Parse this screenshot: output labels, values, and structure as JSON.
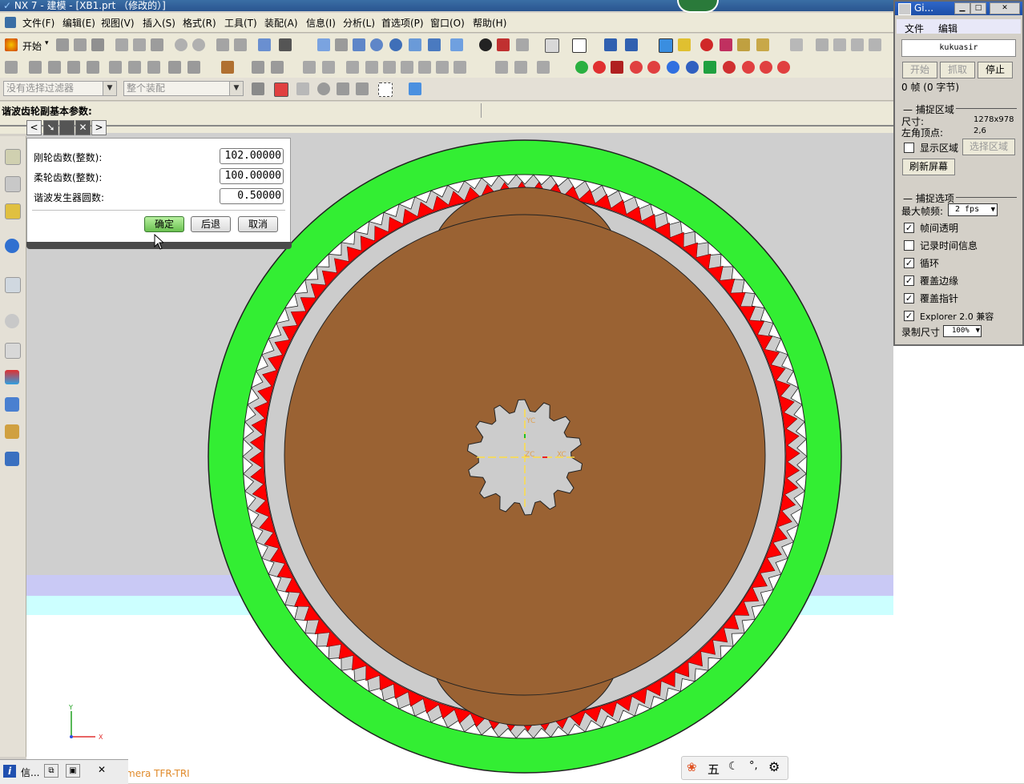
{
  "window": {
    "title": "NX 7 - 建模 - [XB1.prt （修改的）]"
  },
  "menubar": {
    "items": [
      "文件(F)",
      "编辑(E)",
      "视图(V)",
      "插入(S)",
      "格式(R)",
      "工具(T)",
      "装配(A)",
      "信息(I)",
      "分析(L)",
      "首选项(P)",
      "窗口(O)",
      "帮助(H)"
    ]
  },
  "toolbar": {
    "start_label": "开始"
  },
  "filterbar": {
    "filter_placeholder": "没有选择过滤器",
    "assembly_placeholder": "整个装配"
  },
  "cue": {
    "text": "谐波齿轮副基本参数:"
  },
  "dialog": {
    "fields": [
      {
        "label": "刚轮齿数(整数):",
        "value": "102.00000"
      },
      {
        "label": "柔轮齿数(整数):",
        "value": "100.00000"
      },
      {
        "label": "谐波发生器圆数:",
        "value": "0.50000"
      }
    ],
    "ok_label": "确定",
    "back_label": "后退",
    "cancel_label": "取消"
  },
  "viewport": {
    "triad_labels": {
      "x": "X",
      "y": "Y"
    },
    "mini_labels": {
      "yc": "YC",
      "xc": "XC",
      "zc": "ZC"
    },
    "camera_text": "mera TFR-TRI"
  },
  "capture_panel": {
    "title": "Gi...",
    "menu_file": "文件",
    "menu_edit": "编辑",
    "username": "kukuasir",
    "start_label": "开始",
    "grab_label": "抓取",
    "stop_label": "停止",
    "frames_info": "0 帧 (0 字节)",
    "section_region": "捕捉区域",
    "size_label": "尺寸:",
    "size_value": "1278x978",
    "corner_label": "左角顶点:",
    "corner_value": "2,6",
    "show_region_label": "显示区域",
    "select_region_label": "选择区域",
    "refresh_label": "刷新屏幕",
    "section_options": "捕捉选项",
    "max_fps_label": "最大帧频:",
    "max_fps_value": "2 fps",
    "options": [
      {
        "label": "帧间透明",
        "checked": true
      },
      {
        "label": "记录时间信息",
        "checked": false
      },
      {
        "label": "循环",
        "checked": true
      },
      {
        "label": "覆盖边缘",
        "checked": true
      },
      {
        "label": "覆盖指针",
        "checked": true
      },
      {
        "label": "Explorer 2.0 兼容",
        "checked": true
      }
    ],
    "record_size_label": "录制尺寸",
    "record_size_value": "100%"
  },
  "taskbar": {
    "info_label": "信..."
  },
  "ime": {
    "wubi_label": "五"
  },
  "colors": {
    "outer_ring": "#33ee33",
    "teeth": "#ff0000",
    "body": "#9a6233",
    "hub": "#cccccc"
  }
}
